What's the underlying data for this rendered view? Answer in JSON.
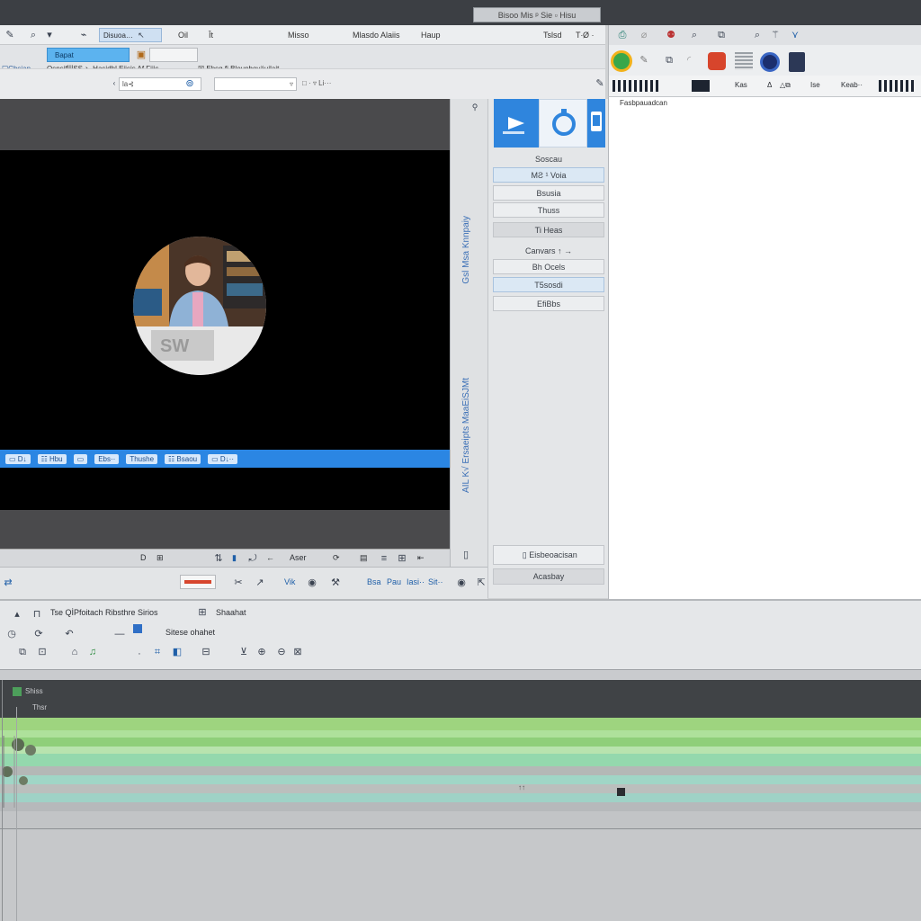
{
  "window": {
    "top_title": "Bisoo Mis ᵖ Sie ▫ Hisu"
  },
  "toolbar": {
    "row1": {
      "blue_tab": "Bapat",
      "field": "Disuoa…",
      "menu": [
        "Oil",
        "Ît",
        "Misso",
        "Mlasdo Alaiis",
        "Haup",
        "Tslsd",
        "T∙Ø ·"
      ]
    },
    "row2": {
      "left_text": "☐Chsian",
      "mid_text": "OsnsifİİİSS ↘ Hasidhl Eiisis Af Fiiis ···",
      "right_text": "☒ Ehsg fi Blounboyäujlait"
    },
    "row3": {
      "field1": "la⊰",
      "field2": "▿",
      "field3": "□ · ▿ Li···"
    }
  },
  "preview": {
    "blue_bar": [
      "▭ D↓",
      "☷ Hbu",
      "▭",
      "Ebs··",
      "Thushe",
      "☷ Bsaou",
      "▭ D↓··"
    ],
    "controls": [
      "D",
      "⊞",
      "▮",
      "←",
      "Aser",
      "⟳",
      "▤",
      "⇤"
    ]
  },
  "vstrip": {
    "text1": "Gsl Msa Knnpaiy",
    "text2": "AIL K√ Ersaeipts MaaEiSJMt"
  },
  "side_buttons": {
    "items": [
      "Soscau",
      "MƧ ¹   Voia",
      "Bsusia",
      "Thuss",
      "Ti Heas",
      "Canvars  ↑ →",
      "Bh Ocels",
      "T5sosdi",
      "EfiBbs"
    ],
    "bottom1": "Eisbeoacisan",
    "bottom2": "Acasbay"
  },
  "right_panel": {
    "row3_labels": [
      "Kas",
      "Δ",
      "△⧉",
      "Ise",
      "Keab··"
    ],
    "body_text": "Fasbpauadcan"
  },
  "mid_toolbar": {
    "texts": [
      "Vik",
      "Bsa",
      "Pau",
      "Iasi··",
      "Sit··"
    ]
  },
  "timeline": {
    "row1_text": "Tse QİPfoitach Ribsthre Sirios",
    "row1_right": "Shaahat",
    "row2_text": "Sitese   ohahet",
    "track_label1": "Shiss",
    "track_label2": "Thsr",
    "marker": "↑↑"
  },
  "colors": {
    "accent": "#2f85dd",
    "green_track": "#9ed47f",
    "teal_track": "#93d3bf",
    "grey_track": "#b0b2b4",
    "video_bg": "#000000"
  }
}
